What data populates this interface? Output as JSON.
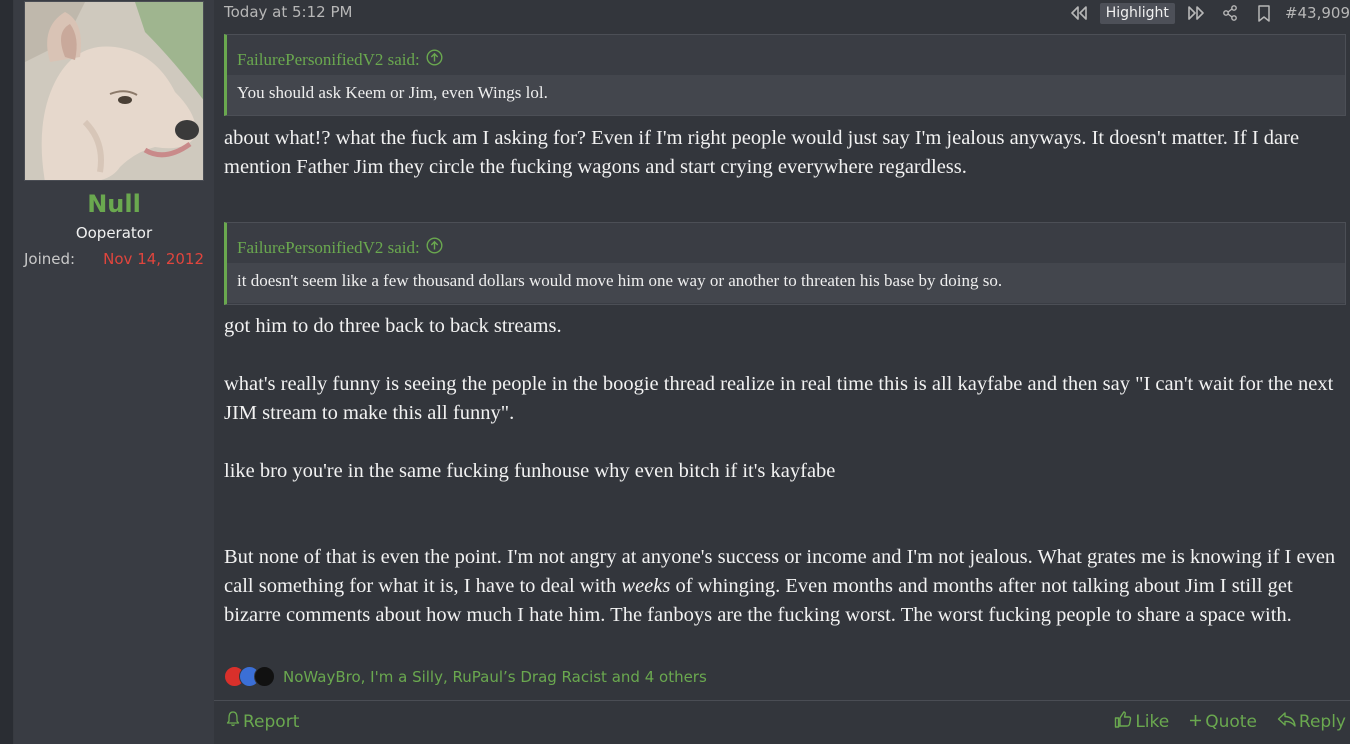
{
  "user": {
    "name": "Null",
    "title": "Ooperator",
    "joined_label": "Joined:",
    "joined_date": "Nov 14, 2012"
  },
  "post": {
    "date": "Today at 5:12 PM",
    "highlight_label": "Highlight",
    "number": "#43,909",
    "quotes": [
      {
        "author": "FailurePersonifiedV2 said:",
        "text": "You should ask Keem or Jim, even Wings lol."
      },
      {
        "author": "FailurePersonifiedV2 said:",
        "text": "it doesn't seem like a few thousand dollars would move him one way or another to threaten his base by doing so."
      }
    ],
    "paragraphs": {
      "p1": "about what!? what the fuck am I asking for? Even if I'm right people would just say I'm jealous anyways. It doesn't matter. If I dare mention Father Jim they circle the fucking wagons and start crying everywhere regardless.",
      "p2": "got him to do three back to back streams.",
      "p3": "what's really funny is seeing the people in the boogie thread realize in real time this is all kayfabe and then say \"I can't wait for the next JIM stream to make this all funny\".",
      "p4": "like bro you're in the same fucking funhouse why even bitch if it's kayfabe",
      "p5_before": "But none of that is even the point. I'm not angry at anyone's success or income and I'm not jealous. What grates me is knowing if I even call something for what it is, I have to deal with ",
      "p5_em": "weeks",
      "p5_after": " of whinging. Even months and months after not talking about Jim I still get bizarre comments about how much I hate him. The fanboys are the fucking worst. The worst fucking people to share a space with."
    },
    "reactions_text": "NoWayBro, I'm a Silly, RuPaul’s Drag Racist and 4 others"
  },
  "footer": {
    "report": "Report",
    "like": "Like",
    "quote": "Quote",
    "reply": "Reply"
  },
  "icons": [
    "rewind-icon",
    "fast-forward-icon",
    "share-icon",
    "bookmark-icon",
    "arrow-up-circle-icon",
    "bell-icon",
    "thumbs-up-icon",
    "plus-icon",
    "reply-icon",
    "heart-reaction-icon",
    "like-reaction-icon",
    "top-hat-reaction-icon"
  ],
  "colors": {
    "accent_green": "#6aa84f",
    "joined_red": "#e0453d",
    "panel": "#393c43",
    "post_bg": "#33363c"
  }
}
